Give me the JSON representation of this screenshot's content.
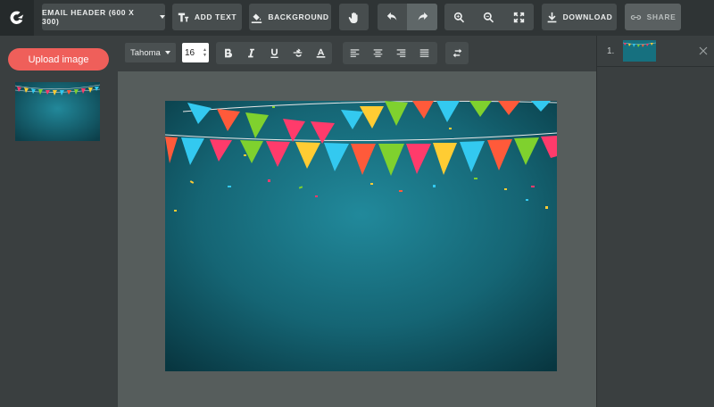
{
  "toolbar": {
    "logo_icon": "brand-logo-icon",
    "size_preset_label": "EMAIL HEADER (600 X 300)",
    "add_text_label": "ADD TEXT",
    "background_label": "BACKGROUND",
    "download_label": "DOWNLOAD",
    "share_label": "SHARE"
  },
  "sidebar": {
    "upload_label": "Upload image"
  },
  "format": {
    "font_family": "Tahoma",
    "font_size": "16"
  },
  "pages": {
    "items": [
      {
        "number": "1."
      }
    ]
  },
  "colors": {
    "accent": "#ef5f5a",
    "toolbar_bg": "#2f3435",
    "canvas_bg": "#565d5c",
    "artboard_bg": "#1d6b7a"
  }
}
